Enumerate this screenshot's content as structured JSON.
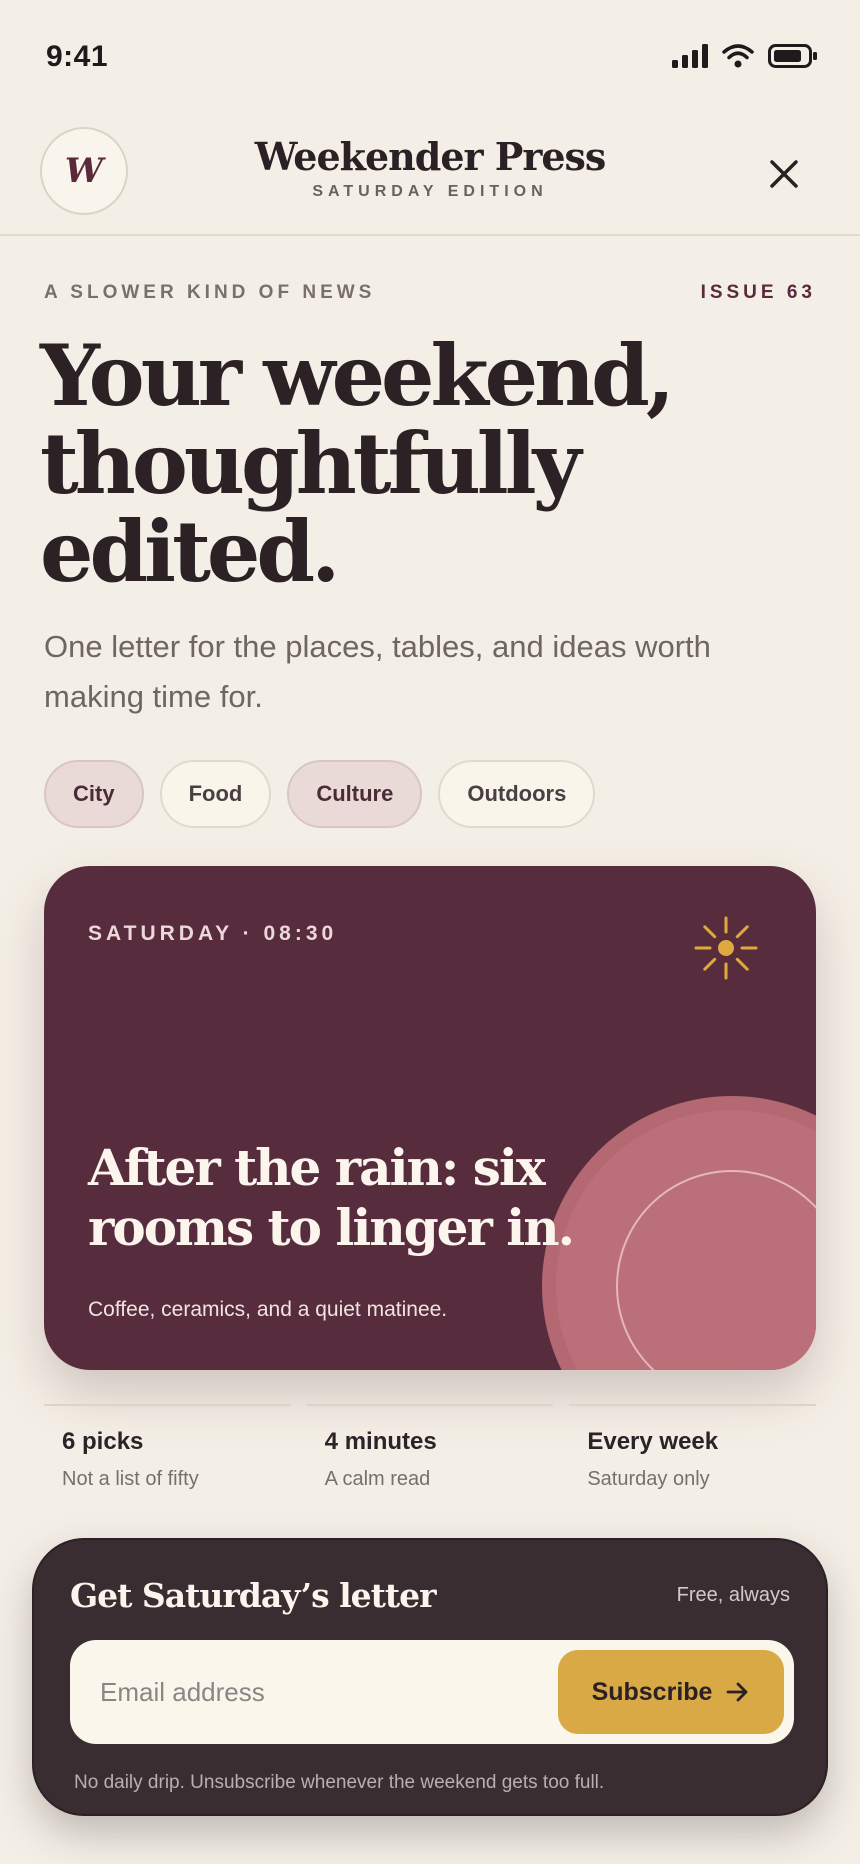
{
  "status": {
    "time": "9:41"
  },
  "header": {
    "logo_letter": "W",
    "name": "Weekender Press",
    "edition": "SATURDAY EDITION"
  },
  "hero": {
    "kicker": "A SLOWER KIND OF NEWS",
    "issue": "ISSUE 63",
    "headline": "Your weekend, thoughtfully edited.",
    "subhead": "One letter for the places, tables, and ideas worth making time for."
  },
  "chips": [
    {
      "label": "City",
      "active": true
    },
    {
      "label": "Food",
      "active": false
    },
    {
      "label": "Culture",
      "active": true
    },
    {
      "label": "Outdoors",
      "active": false
    }
  ],
  "feature": {
    "meta": "SATURDAY · 08:30",
    "title": "After the rain: six rooms to linger in.",
    "description": "Coffee, ceramics, and a quiet matinee."
  },
  "stats": [
    {
      "value": "6 picks",
      "label": "Not a list of fifty"
    },
    {
      "value": "4 minutes",
      "label": "A calm read"
    },
    {
      "value": "Every week",
      "label": "Saturday only"
    }
  ],
  "subscribe": {
    "title": "Get Saturday’s letter",
    "tag": "Free, always",
    "email_placeholder": "Email address",
    "email_value": "",
    "button_label": "Subscribe",
    "fine_print": "No daily drip. Unsubscribe whenever the weekend gets too full."
  },
  "colors": {
    "background": "#f4efe6",
    "accent_plum": "#572d3d",
    "accent_gold": "#d8a944",
    "rose": "#b96d77",
    "dark_panel": "#3a2d32"
  },
  "icons": [
    "signal-icon",
    "wifi-icon",
    "battery-icon",
    "close-icon",
    "sun-icon",
    "arrow-right-icon"
  ]
}
